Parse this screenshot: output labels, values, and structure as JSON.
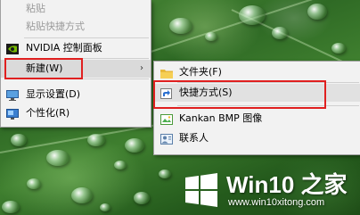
{
  "context_menu": {
    "items": [
      {
        "label": "粘贴",
        "disabled": true
      },
      {
        "label": "粘贴快捷方式",
        "disabled": true
      },
      {
        "label": "NVIDIA 控制面板",
        "icon": "nvidia-icon"
      },
      {
        "label": "新建(W)",
        "has_submenu": true
      },
      {
        "label": "显示设置(D)",
        "icon": "display-icon"
      },
      {
        "label": "个性化(R)",
        "icon": "personalize-icon"
      }
    ]
  },
  "new_submenu": {
    "items": [
      {
        "label": "文件夹(F)",
        "icon": "folder-icon"
      },
      {
        "label": "快捷方式(S)",
        "icon": "shortcut-icon"
      },
      {
        "label": "Kankan BMP 图像",
        "icon": "bmp-image-icon"
      },
      {
        "label": "联系人",
        "icon": "contact-icon"
      }
    ]
  },
  "watermark": {
    "brand": "Win10 之家",
    "url": "www.win10xitong.com"
  },
  "colors": {
    "highlight_box": "#e02020",
    "menu_bg": "#f2f2f2"
  }
}
